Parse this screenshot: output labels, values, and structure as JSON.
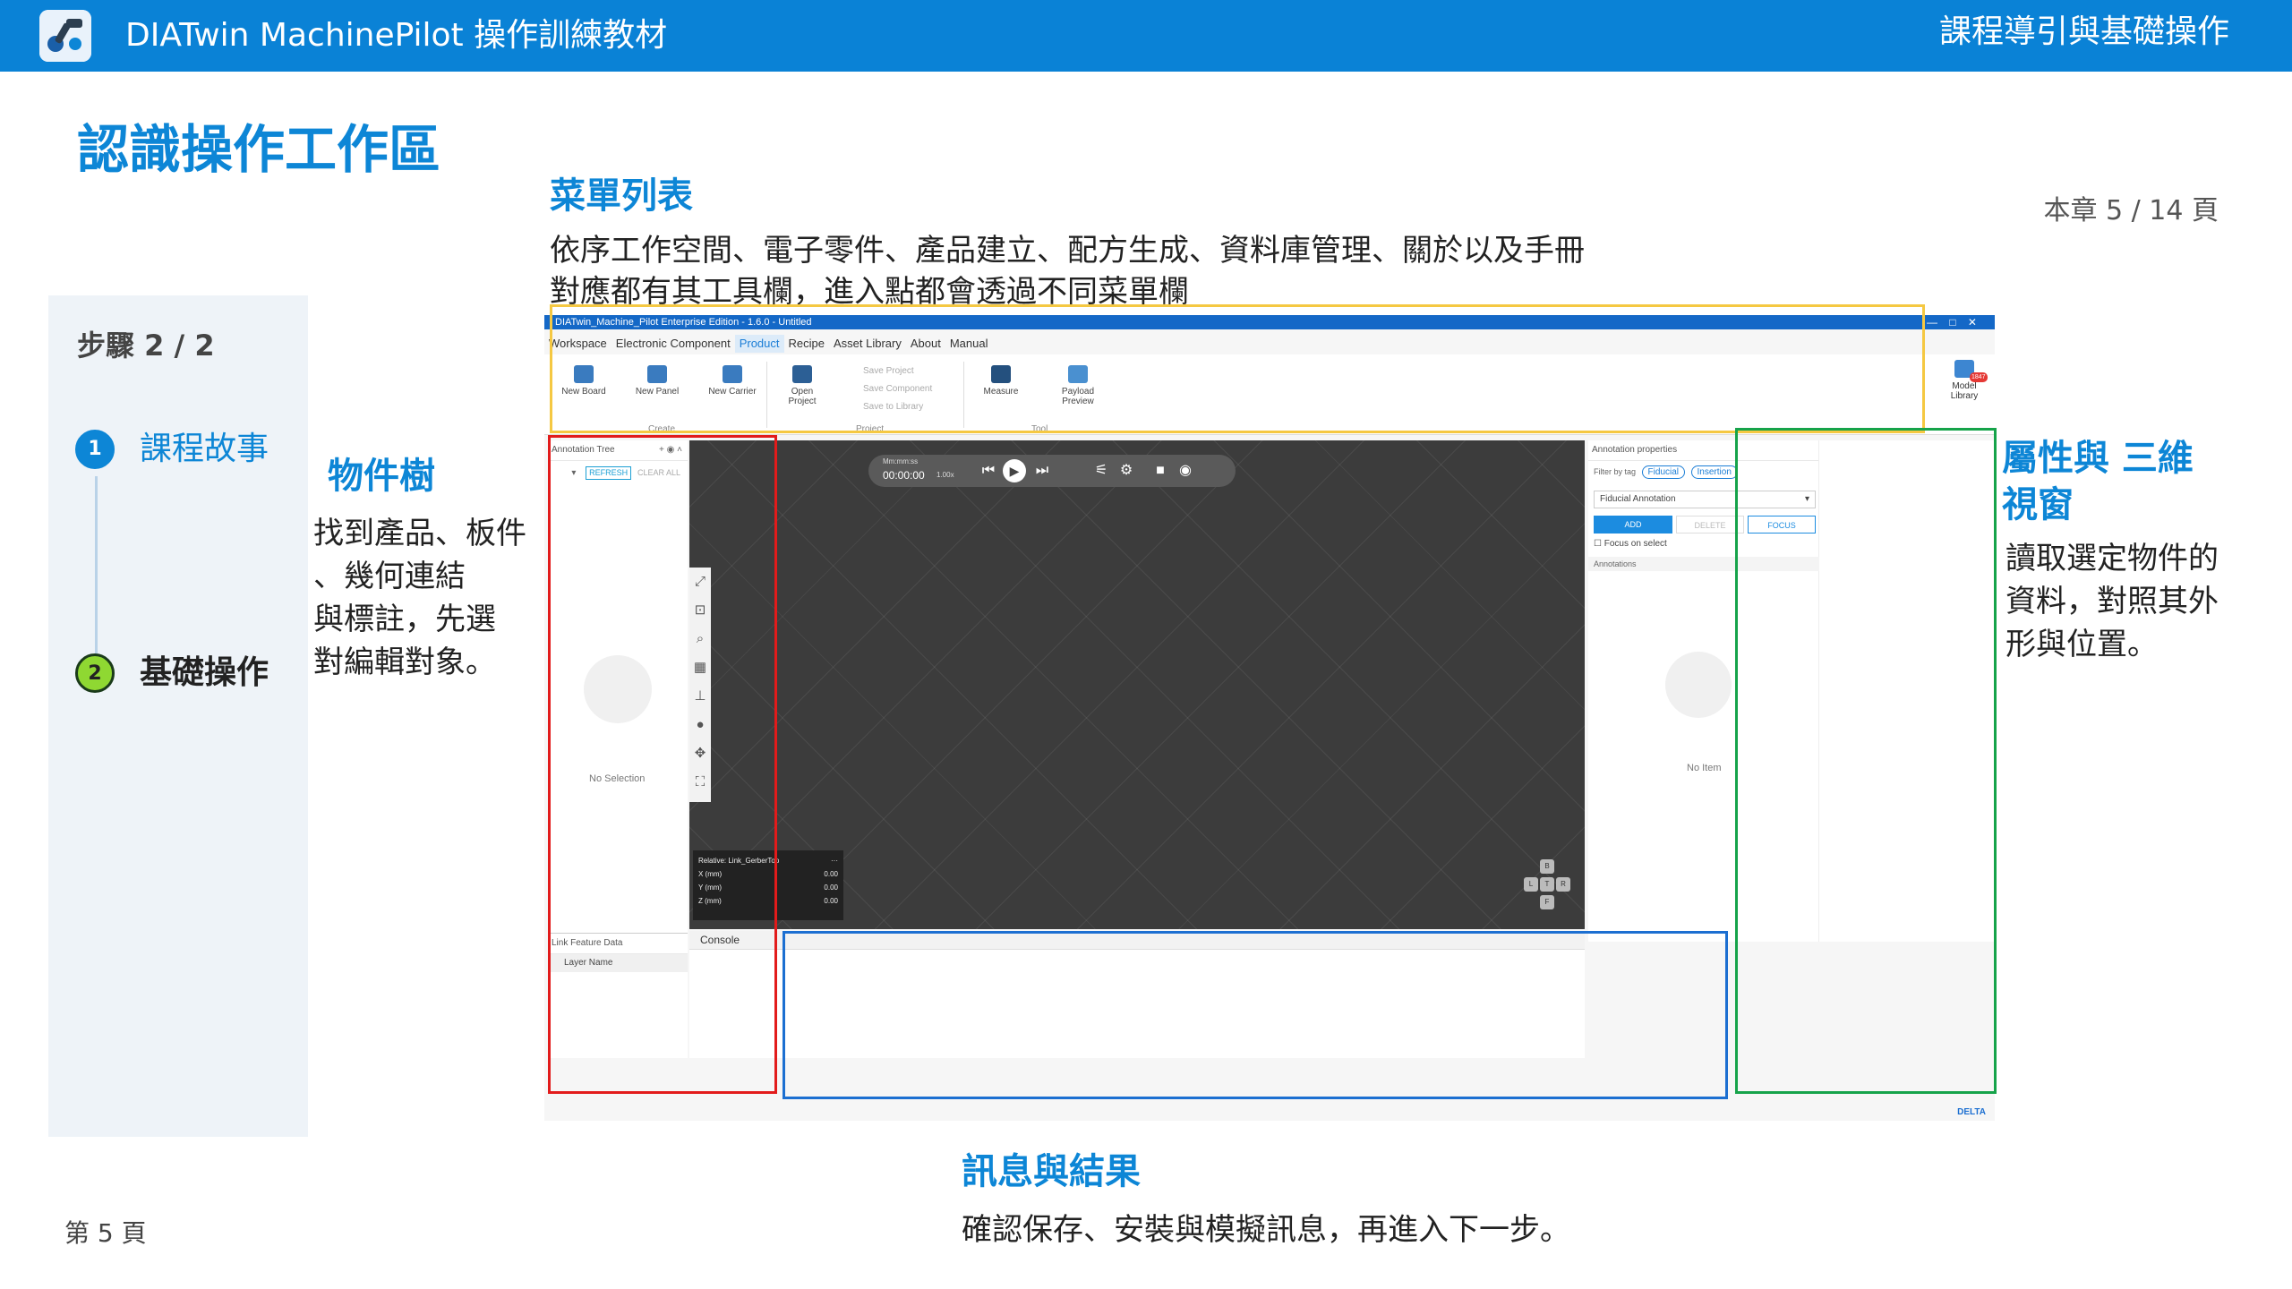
{
  "header": {
    "app_title": "DIATwin MachinePilot 操作訓練教材",
    "section_title": "課程導引與基礎操作"
  },
  "page": {
    "heading": "認識操作工作區",
    "chapter_count": "本章 5 / 14 頁",
    "page_number": "第 5 頁"
  },
  "stepper": {
    "step_count": "步驟 2 / 2",
    "steps": [
      {
        "number": "1",
        "label": "課程故事",
        "state": "done"
      },
      {
        "number": "2",
        "label": "基礎操作",
        "state": "current"
      }
    ]
  },
  "callouts": {
    "menu": {
      "title": "菜單列表",
      "lines": [
        "依序工作空間、電子零件、產品建立、配方生成、資料庫管理、關於以及手冊",
        "對應都有其工具欄，進入點都會透過不同菜單欄"
      ],
      "color": "#f5c842"
    },
    "tree": {
      "title": "物件樹",
      "lines": [
        "找到產品、板件",
        "、幾何連結",
        "與標註，先選",
        "對編輯對象。"
      ],
      "color": "#e21b1b"
    },
    "properties": {
      "title_lines": [
        "屬性與 三維",
        "視窗"
      ],
      "lines": [
        "讀取選定物件的",
        "資料，對照其外",
        "形與位置。"
      ],
      "color": "#16a34a"
    },
    "messages": {
      "title": "訊息與結果",
      "text": "確認保存、安裝與模擬訊息，再進入下一步。",
      "color": "#1c6fd1"
    }
  },
  "app": {
    "window_title": "DIATwin_Machine_Pilot Enterprise Edition - 1.6.0 - Untitled",
    "menus": [
      "Workspace",
      "Electronic Component",
      "Product",
      "Recipe",
      "Asset Library",
      "About",
      "Manual"
    ],
    "active_menu": "Product",
    "toolbar": {
      "new_board": "New Board",
      "new_panel": "New Panel",
      "new_carrier": "New Carrier",
      "open_project": "Open Project",
      "save_project": "Save Project",
      "save_component": "Save Component",
      "save_to_library": "Save to Library",
      "measure": "Measure",
      "payload_preview": "Payload Preview",
      "model_library": "Model Library",
      "model_badge": "1847",
      "group_create": "Create",
      "group_project": "Project",
      "group_tool": "Tool"
    },
    "annotation_tree": {
      "title": "Annotation Tree",
      "refresh": "REFRESH",
      "clear_all": "CLEAR ALL",
      "empty": "No Selection"
    },
    "link_feature": {
      "title": "Link Feature Data",
      "column": "Layer Name"
    },
    "playback": {
      "mode": "Mm:mm:ss",
      "time": "00:00:00",
      "speed": "1.00x"
    },
    "coords": {
      "title": "Relative: Link_GerberTop",
      "x_label": "X (mm)",
      "x": "0.00",
      "y_label": "Y (mm)",
      "y": "0.00",
      "z_label": "Z (mm)",
      "z": "0.00"
    },
    "view_cube": {
      "b": "B",
      "l": "L",
      "t": "T",
      "r": "R",
      "f": "F"
    },
    "console": {
      "title": "Console"
    },
    "properties": {
      "title": "Annotation properties",
      "filter_label": "Filter by tag",
      "tag_fiducial": "Fiducial",
      "tag_insertion": "Insertion",
      "select_value": "Fiducial Annotation",
      "add": "ADD",
      "delete": "DELETE",
      "focus": "FOCUS",
      "focus_on_select": "Focus on select",
      "annotations": "Annotations",
      "empty": "No Item"
    },
    "footer_brand": "DELTA"
  },
  "colors": {
    "header_bg": "#0a82d6",
    "accent": "#0d86d6",
    "step_done": "#0d86d6",
    "step_current": "#8fd832"
  }
}
